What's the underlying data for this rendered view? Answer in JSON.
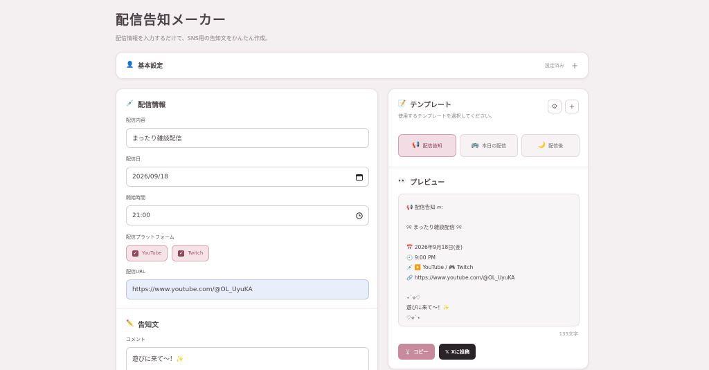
{
  "app": {
    "title": "配信告知メーカー",
    "subtitle": "配信情報を入力するだけで、SNS用の告知文をかんたん作成。"
  },
  "settings": {
    "icon": "👤",
    "title": "基本設定",
    "status": "設定済み",
    "toggle": "+"
  },
  "stream_info": {
    "icon": "💉",
    "title": "配信情報",
    "content_label": "配信内容",
    "content_value": "まったり雑談配信",
    "date_label": "配信日",
    "date_value": "2026/09/18",
    "time_label": "開始時間",
    "time_value": "21:00",
    "platform_label": "配信プラットフォーム",
    "platforms": [
      {
        "label": "YouTube",
        "checked": true
      },
      {
        "label": "Twitch",
        "checked": true
      }
    ],
    "url_label": "配信URL",
    "url_value": "https://www.youtube.com/@OL_UyuKA"
  },
  "announcement": {
    "icon": "✏️",
    "title": "告知文",
    "comment_label": "コメント",
    "comment_value": "遊びに来て〜！✨"
  },
  "template": {
    "icon": "📝",
    "title": "テンプレート",
    "subtitle": "使用するテンプレートを選択してください。",
    "settings_icon": "⚙",
    "add_icon": "+",
    "options": [
      {
        "icon": "📢",
        "label": "配信告知",
        "active": true
      },
      {
        "icon": "🚌",
        "label": "本日の配信",
        "active": false
      },
      {
        "icon": "🌙",
        "label": "配信後",
        "active": false
      }
    ]
  },
  "preview": {
    "icon": "👀",
    "title": "プレビュー",
    "lines": [
      "📢 配信告知 ო:",
      "",
      "୨୧ まったり雑談配信 ୨୧",
      "",
      "📅 2026年9月18日(金)",
      "🕘 9:00 PM",
      "💉 ▶️ YouTube / 🎮 Twitch",
      "🔗 https://www.youtube.com/@OL_UyuKA",
      "",
      "⋆˙⟡♡",
      "遊びに来て〜！✨",
      "♡⟡˙⋆"
    ],
    "char_count": "135文字",
    "copy_label": "コピー",
    "copy_icon": "🐰",
    "post_label": "Xに投稿",
    "post_icon": "𝕏"
  }
}
